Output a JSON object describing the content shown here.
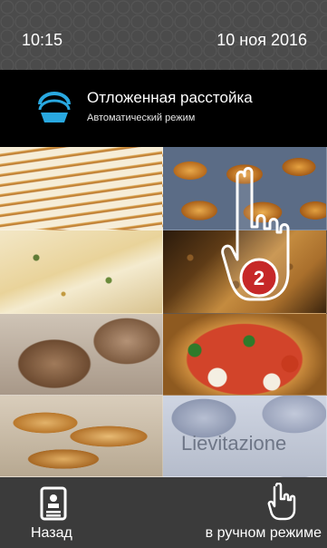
{
  "status": {
    "time": "10:15",
    "date": "10 ноя 2016"
  },
  "header": {
    "icon": "dough-bowl-icon",
    "title": "Отложенная расстойка",
    "subtitle": "Автоматический режим"
  },
  "tiles": [
    {
      "id": "napoleon"
    },
    {
      "id": "croissants"
    },
    {
      "id": "focaccia"
    },
    {
      "id": "bread-crumb"
    },
    {
      "id": "buns"
    },
    {
      "id": "pizza"
    },
    {
      "id": "baguettes"
    },
    {
      "id": "lievitazione",
      "caption": "Lievitazione"
    }
  ],
  "overlay": {
    "icon": "hand-pointer-icon",
    "step_number": "2",
    "badge_color": "#c62828"
  },
  "bottom": {
    "back_label": "Назад",
    "back_icon": "back-document-icon",
    "manual_label": "в ручном режиме",
    "manual_icon": "hand-pointer-icon"
  },
  "colors": {
    "accent_blue": "#29a8e0",
    "header_bg": "#000000",
    "bar_bg": "#3b3b3b"
  }
}
